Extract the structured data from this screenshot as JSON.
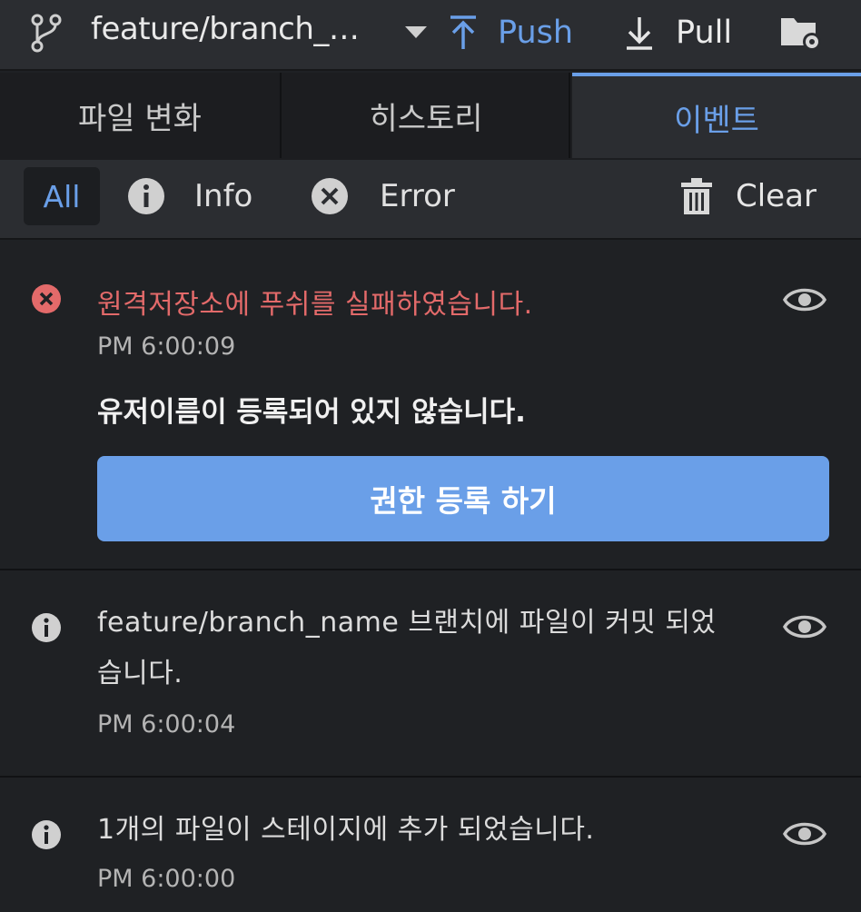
{
  "topbar": {
    "branch_name": "feature/branch_…",
    "push_label": "Push",
    "pull_label": "Pull",
    "colors": {
      "accent": "#6a9fe8",
      "background": "#2b2d31"
    },
    "icons": [
      "git-branch-icon",
      "chevron-down-icon",
      "push-arrow-icon",
      "pull-arrow-icon",
      "folder-settings-icon"
    ]
  },
  "tabs": [
    {
      "label": "파일 변화",
      "active": false
    },
    {
      "label": "히스토리",
      "active": false
    },
    {
      "label": "이벤트",
      "active": true
    }
  ],
  "filters": {
    "all_label": "All",
    "info_label": "Info",
    "error_label": "Error",
    "clear_label": "Clear",
    "selected": "All"
  },
  "events": [
    {
      "level": "error",
      "title": "원격저장소에 푸쉬를 실패하였습니다.",
      "time": "PM 6:00:09",
      "message": "유저이름이 등록되어 있지 않습니다.",
      "action_label": "권한 등록 하기",
      "color": "#e36a6a"
    },
    {
      "level": "info",
      "title": "feature/branch_name 브랜치에 파일이 커밋 되었습니다.",
      "time": "PM 6:00:04"
    },
    {
      "level": "info",
      "title": "1개의 파일이 스테이지에 추가 되었습니다.",
      "time": "PM 6:00:00"
    }
  ]
}
